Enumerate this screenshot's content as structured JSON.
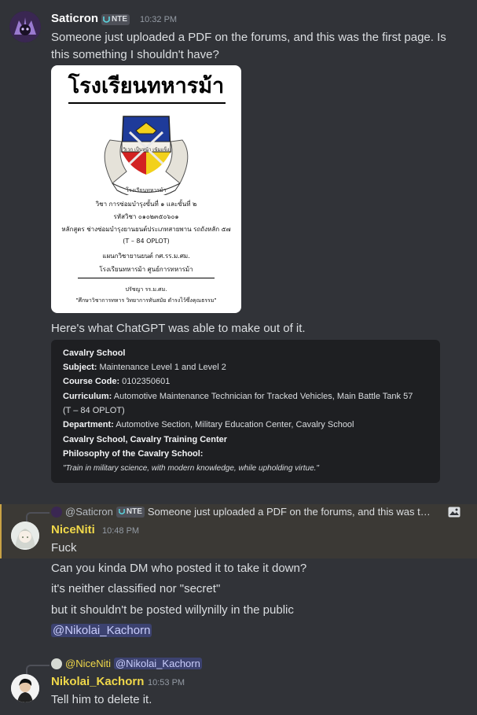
{
  "messages": [
    {
      "author": "Saticron",
      "badge": "NTE",
      "time": "10:32 PM",
      "lines": [
        "Someone just uploaded a PDF on the forums, and this was the first page. Is",
        "this something I shouldn't have?"
      ],
      "attachment": {
        "title": "โรงเรียนทหารม้า",
        "emblem_caption": "โรงเรียนทหารม้า",
        "emblem_motto": "วิเวก เป็นหน้า เข้มแข็ง",
        "lines": [
          "วิชา การซ่อมบำรุงขั้นที่ ๑ และขั้นที่ ๒",
          "รหัสวิชา ๐๑๐๒๓๕๐๖๐๑",
          "หลักสูตร ช่างซ่อมบำรุงยานยนต์ประเภทสายพาน รถถังหลัก ๕๗",
          "(T – 84 OPLOT)",
          "แผนกวิชายานยนต์ กศ.รร.ม.ศม.",
          "โรงเรียนทหารม้า  ศูนย์การทหารม้า",
          "ปรัชญา รร.ม.ศม.",
          "\"ศึกษาวิชาการทหาร วิทยาการทันสมัย ดำรงไว้ซึ่งคุณธรรม\""
        ]
      },
      "after_text": "Here's what ChatGPT was able to make out of it.",
      "code": [
        {
          "bold": "Cavalry School",
          "rest": ""
        },
        {
          "bold": "Subject:",
          "rest": " Maintenance Level 1 and Level 2"
        },
        {
          "bold": "Course Code:",
          "rest": " 0102350601"
        },
        {
          "bold": "Curriculum:",
          "rest": " Automotive Maintenance Technician for Tracked Vehicles, Main Battle Tank 57"
        },
        {
          "bold": "",
          "rest": "(T – 84 OPLOT)"
        },
        {
          "bold": "Department:",
          "rest": " Automotive Section, Military Education Center, Cavalry School"
        },
        {
          "bold": "Cavalry School, Cavalry Training Center",
          "rest": ""
        },
        {
          "bold": "Philosophy of the Cavalry School:",
          "rest": ""
        },
        {
          "bold": "",
          "rest": "\"Train in military science, with modern knowledge, while upholding virtue.\"",
          "italic": true
        }
      ]
    }
  ],
  "reply1": {
    "ref_author": "@Saticron",
    "ref_badge": "NTE",
    "ref_text": "Someone just uploaded a PDF on the forums, and this was t…",
    "ref_icon": "image-icon",
    "author": "NiceNiti",
    "time": "10:48 PM",
    "lines": [
      "Fuck",
      "Can you kinda DM who posted it to take it down?",
      "it's neither classified nor \"secret\"",
      "but it shouldn't be posted willynilly in the public"
    ],
    "mention": "@Nikolai_Kachorn"
  },
  "reply2": {
    "ref_author": "@NiceNiti",
    "ref_mention": "@Nikolai_Kachorn",
    "author": "Nikolai_Kachorn",
    "time": "10:53 PM",
    "text": "Tell him to delete it."
  },
  "colors": {
    "background": "#313338",
    "author_saticron": "#ffffff",
    "author_gold": "#f0d84a",
    "mention_bg": "#3c4270",
    "codeblock_bg": "#1e1f22",
    "highlight_edge": "#c9a245"
  }
}
